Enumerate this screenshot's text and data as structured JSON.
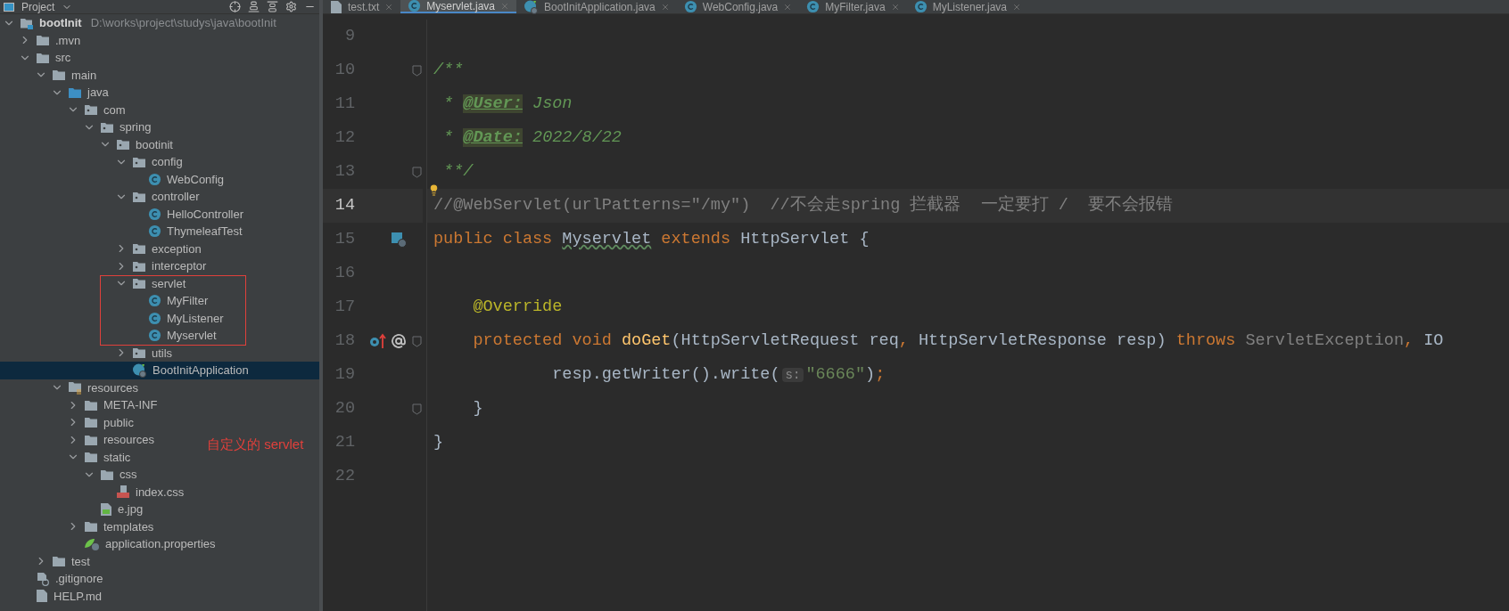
{
  "sidebar": {
    "title": "Project",
    "tree": [
      {
        "label": "bootInit",
        "path": "D:\\works\\project\\studys\\java\\bootInit",
        "kind": "root",
        "expanded": true,
        "selected": false,
        "children": [
          {
            "label": ".mvn",
            "kind": "folder",
            "expanded": false,
            "selected": false
          },
          {
            "label": "src",
            "kind": "folder",
            "expanded": true,
            "selected": false,
            "children": [
              {
                "label": "main",
                "kind": "folder",
                "expanded": true,
                "selected": false,
                "children": [
                  {
                    "label": "java",
                    "kind": "source",
                    "expanded": true,
                    "selected": false,
                    "children": [
                      {
                        "label": "com",
                        "kind": "package",
                        "expanded": true,
                        "selected": false,
                        "children": [
                          {
                            "label": "spring",
                            "kind": "package",
                            "expanded": true,
                            "selected": false,
                            "children": [
                              {
                                "label": "bootinit",
                                "kind": "package",
                                "expanded": true,
                                "selected": false,
                                "children": [
                                  {
                                    "label": "config",
                                    "kind": "package",
                                    "expanded": true,
                                    "selected": false,
                                    "children": [
                                      {
                                        "label": "WebConfig",
                                        "kind": "class",
                                        "selected": false
                                      }
                                    ]
                                  },
                                  {
                                    "label": "controller",
                                    "kind": "package",
                                    "expanded": true,
                                    "selected": false,
                                    "children": [
                                      {
                                        "label": "HelloController",
                                        "kind": "class",
                                        "selected": false
                                      },
                                      {
                                        "label": "ThymeleafTest",
                                        "kind": "class",
                                        "selected": false
                                      }
                                    ]
                                  },
                                  {
                                    "label": "exception",
                                    "kind": "package",
                                    "expanded": false,
                                    "selected": false
                                  },
                                  {
                                    "label": "interceptor",
                                    "kind": "package",
                                    "expanded": false,
                                    "selected": false
                                  },
                                  {
                                    "label": "servlet",
                                    "kind": "package",
                                    "expanded": true,
                                    "selected": false,
                                    "annotated": true,
                                    "children": [
                                      {
                                        "label": "MyFilter",
                                        "kind": "class",
                                        "selected": false
                                      },
                                      {
                                        "label": "MyListener",
                                        "kind": "class",
                                        "selected": false
                                      },
                                      {
                                        "label": "Myservlet",
                                        "kind": "class",
                                        "selected": false
                                      }
                                    ]
                                  },
                                  {
                                    "label": "utils",
                                    "kind": "package",
                                    "expanded": false,
                                    "selected": false
                                  },
                                  {
                                    "label": "BootInitApplication",
                                    "kind": "app",
                                    "selected": true
                                  }
                                ]
                              }
                            ]
                          }
                        ]
                      }
                    ]
                  },
                  {
                    "label": "resources",
                    "kind": "resources",
                    "expanded": true,
                    "selected": false,
                    "children": [
                      {
                        "label": "META-INF",
                        "kind": "folder",
                        "expanded": false,
                        "selected": false
                      },
                      {
                        "label": "public",
                        "kind": "folder",
                        "expanded": false,
                        "selected": false
                      },
                      {
                        "label": "resources",
                        "kind": "folder",
                        "expanded": false,
                        "selected": false
                      },
                      {
                        "label": "static",
                        "kind": "folder",
                        "expanded": true,
                        "selected": false,
                        "children": [
                          {
                            "label": "css",
                            "kind": "folder",
                            "expanded": true,
                            "selected": false,
                            "children": [
                              {
                                "label": "index.css",
                                "kind": "css",
                                "selected": false
                              }
                            ]
                          },
                          {
                            "label": "e.jpg",
                            "kind": "image",
                            "selected": false
                          }
                        ]
                      },
                      {
                        "label": "templates",
                        "kind": "folder",
                        "expanded": false,
                        "selected": false
                      },
                      {
                        "label": "application.properties",
                        "kind": "properties",
                        "selected": false
                      }
                    ]
                  }
                ]
              },
              {
                "label": "test",
                "kind": "folder",
                "expanded": false,
                "selected": false
              }
            ]
          },
          {
            "label": ".gitignore",
            "kind": "gitignore",
            "selected": false
          },
          {
            "label": "HELP.md",
            "kind": "markdown",
            "selected": false
          }
        ]
      }
    ]
  },
  "annotation": "自定义的 servlet",
  "tabs": [
    {
      "label": "test.txt",
      "kind": "text",
      "selected": false
    },
    {
      "label": "Myservlet.java",
      "kind": "class",
      "selected": true
    },
    {
      "label": "BootInitApplication.java",
      "kind": "app",
      "selected": false
    },
    {
      "label": "WebConfig.java",
      "kind": "class",
      "selected": false
    },
    {
      "label": "MyFilter.java",
      "kind": "class",
      "selected": false
    },
    {
      "label": "MyListener.java",
      "kind": "class",
      "selected": false
    }
  ],
  "editor": {
    "lines": [
      {
        "number": "9",
        "current": false,
        "fold": false
      },
      {
        "number": "10",
        "current": false,
        "fold": true,
        "tokens": [
          {
            "text": "/**",
            "kind": "doc"
          }
        ]
      },
      {
        "number": "11",
        "current": false,
        "fold": false,
        "tokens": [
          {
            "text": " * ",
            "kind": "doc"
          },
          {
            "text": "@User:",
            "kind": "doctag"
          },
          {
            "text": " Json",
            "kind": "doc"
          }
        ]
      },
      {
        "number": "12",
        "current": false,
        "fold": false,
        "tokens": [
          {
            "text": " * ",
            "kind": "doc"
          },
          {
            "text": "@Date:",
            "kind": "doctag"
          },
          {
            "text": " 2022/8/22",
            "kind": "doc"
          }
        ]
      },
      {
        "number": "13",
        "current": false,
        "fold": true,
        "bulb": true,
        "tokens": [
          {
            "text": " **/",
            "kind": "doc"
          }
        ]
      },
      {
        "number": "14",
        "current": true,
        "fold": false,
        "tokens": [
          {
            "text": "//@WebServlet(urlPatterns=\"/my\")  //不会走spring 拦截器  一定要打 /  要不会报错",
            "kind": "comment"
          }
        ]
      },
      {
        "number": "15",
        "current": false,
        "fold": false,
        "implements_marker": true,
        "tokens": [
          {
            "text": "public class ",
            "kind": "keyword"
          },
          {
            "text": "Myservlet",
            "kind": "squiggle"
          },
          {
            "text": " extends ",
            "kind": "keyword"
          },
          {
            "text": "HttpServlet {",
            "kind": "plain"
          }
        ]
      },
      {
        "number": "16",
        "current": false,
        "fold": false
      },
      {
        "number": "17",
        "current": false,
        "fold": false,
        "tokens": [
          {
            "text": "    @Override",
            "kind": "annotation"
          }
        ]
      },
      {
        "number": "18",
        "current": false,
        "fold": true,
        "override_marker": true,
        "tokens": [
          {
            "text": "    protected void ",
            "kind": "keyword"
          },
          {
            "text": "doGet",
            "kind": "method"
          },
          {
            "text": "(HttpServletRequest req",
            "kind": "plain"
          },
          {
            "text": ", ",
            "kind": "keyword"
          },
          {
            "text": "HttpServletResponse resp) ",
            "kind": "plain"
          },
          {
            "text": "throws ",
            "kind": "keyword"
          },
          {
            "text": "ServletException",
            "kind": "muted"
          },
          {
            "text": ", ",
            "kind": "keyword"
          },
          {
            "text": "IO",
            "kind": "plain"
          }
        ]
      },
      {
        "number": "19",
        "current": false,
        "fold": false,
        "tokens": [
          {
            "text": "            resp.getWriter().write(",
            "kind": "plain"
          },
          {
            "text": "s:",
            "kind": "hint"
          },
          {
            "text": "\"6666\"",
            "kind": "string"
          },
          {
            "text": ")",
            "kind": "plain"
          },
          {
            "text": ";",
            "kind": "keyword"
          }
        ]
      },
      {
        "number": "20",
        "current": false,
        "fold": true,
        "tokens": [
          {
            "text": "    }",
            "kind": "plain"
          }
        ]
      },
      {
        "number": "21",
        "current": false,
        "fold": false,
        "tokens": [
          {
            "text": "}",
            "kind": "plain"
          }
        ]
      },
      {
        "number": "22",
        "current": false,
        "fold": false
      }
    ]
  }
}
